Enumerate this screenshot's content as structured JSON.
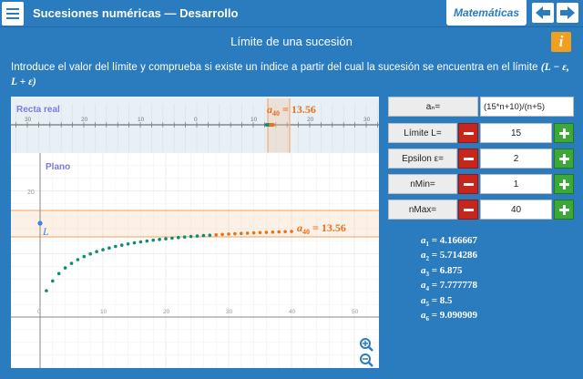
{
  "header": {
    "title": "Sucesiones numéricas — Desarrollo",
    "subject": "Matemáticas"
  },
  "subtitle": "Límite de una sucesión",
  "instruction": {
    "text": "Introduce el valor del límite y comprueba si existe un índice a partir del cual la sucesión se encuentra en el límite",
    "math": "(L − ε, L + ε)"
  },
  "real_line": {
    "label": "Recta real",
    "ticks": [
      "30",
      "20",
      "10",
      "0",
      "10",
      "20",
      "30"
    ],
    "annotation_prefix": "a",
    "annotation_sub": "40",
    "annotation_value": "= 13.56"
  },
  "plane": {
    "label": "Plano",
    "y_tick": "20",
    "x_ticks": [
      "0",
      "10",
      "20",
      "30",
      "40",
      "50"
    ],
    "limit_label": "L",
    "annotation_prefix": "a",
    "annotation_sub": "40",
    "annotation_value": "= 13.56"
  },
  "controls": {
    "formula_label": "aₙ=",
    "formula_value": "(15*n+10)/(n+5)",
    "limit_label": "Límite L=",
    "limit_value": "15",
    "epsilon_label": "Epsilon ε=",
    "epsilon_value": "2",
    "nmin_label": "nMin=",
    "nmin_value": "1",
    "nmax_label": "nMax=",
    "nmax_value": "40"
  },
  "terms": [
    {
      "sub": "1",
      "value": "= 4.166667"
    },
    {
      "sub": "2",
      "value": "= 5.714286"
    },
    {
      "sub": "3",
      "value": "= 6.875"
    },
    {
      "sub": "4",
      "value": "= 7.777778"
    },
    {
      "sub": "5",
      "value": "= 8.5"
    },
    {
      "sub": "6",
      "value": "= 9.090909"
    }
  ],
  "sequence": {
    "n_min": 1,
    "n_max": 40,
    "first_in_band": 28,
    "limit": 15,
    "epsilon": 2
  },
  "colors": {
    "accent": "#2a7cbf",
    "point_outside": "#0e8c6f",
    "point_inside": "#e8711a",
    "limit_point": "#3c82e6",
    "minus": "#c8261b",
    "plus": "#3aa935",
    "info": "#f0a020"
  },
  "icons": {
    "menu": "menu-icon",
    "back": "arrow-left-icon",
    "forward": "arrow-right-icon",
    "info": "info-icon",
    "zoom_in": "zoom-in-icon",
    "zoom_out": "zoom-out-icon"
  }
}
